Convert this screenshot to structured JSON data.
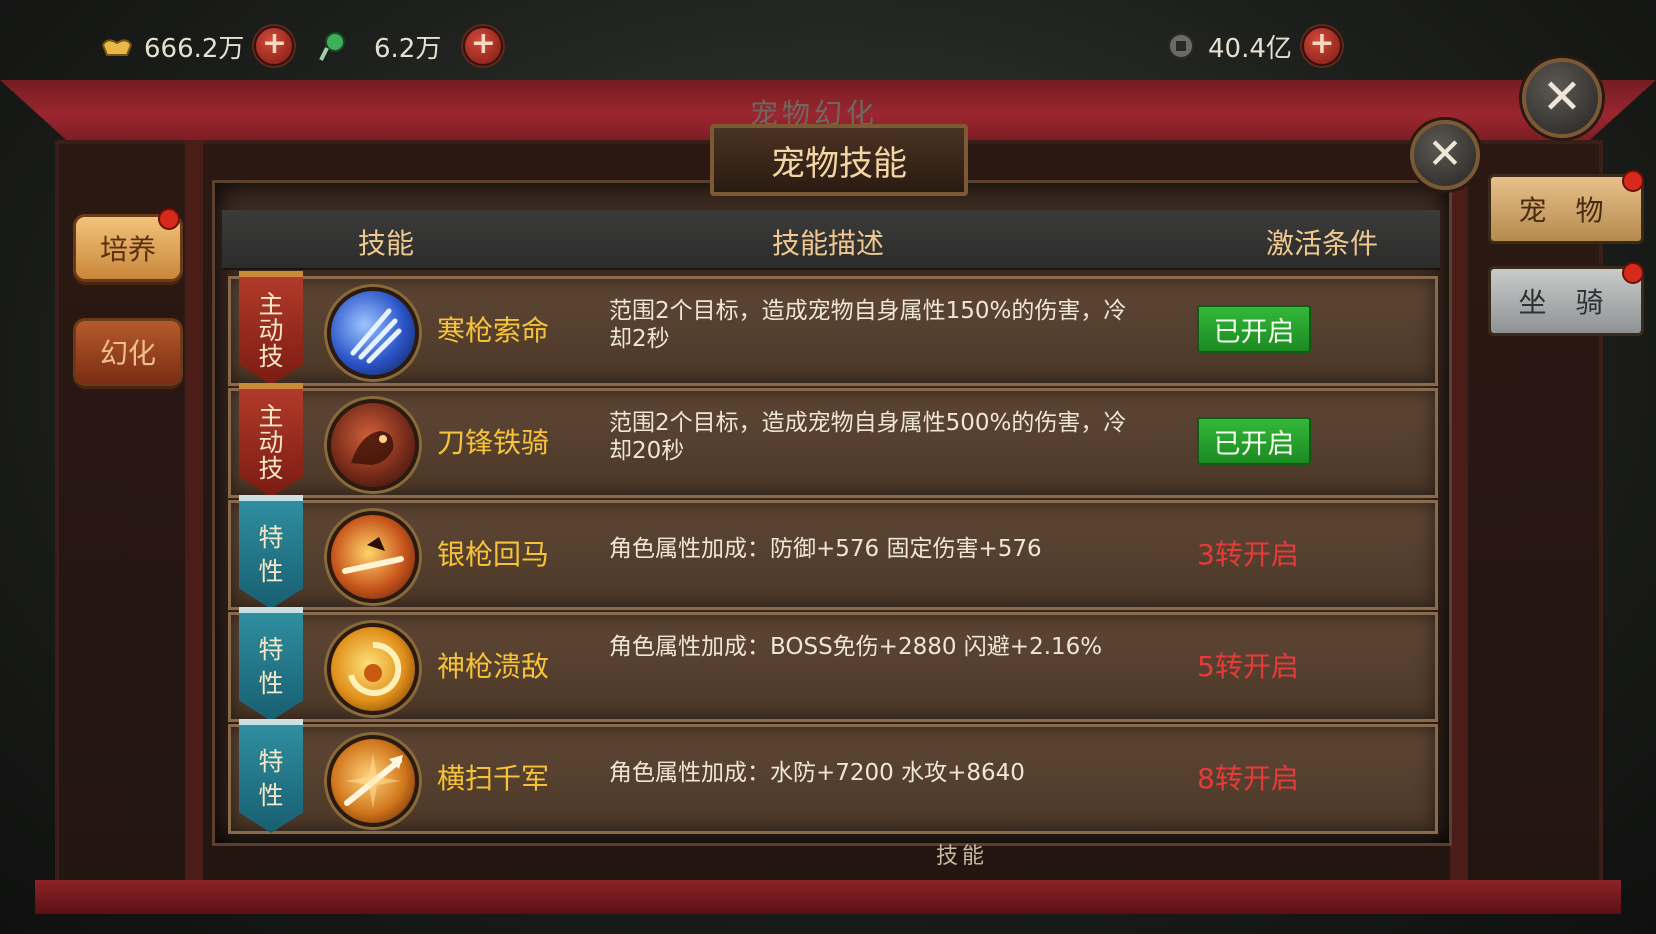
{
  "resources": [
    {
      "icon": "gold-ingot-icon",
      "value": "666.2万"
    },
    {
      "icon": "jade-icon",
      "value": "6.2万"
    },
    {
      "icon": "coin-icon",
      "value": "40.4亿"
    }
  ],
  "side_tabs": [
    "培养",
    "幻化"
  ],
  "right_tabs": [
    "宠 物",
    "坐 骑"
  ],
  "background_title": "宠物幻化",
  "dialog": {
    "title": "宠物技能",
    "headers": {
      "skill": "技能",
      "description": "技能描述",
      "condition": "激活条件"
    },
    "rows": [
      {
        "type": "主动技",
        "type_chars": [
          "主",
          "动",
          "技"
        ],
        "kind": "active",
        "name": "寒枪索命",
        "desc": "范围2个目标，造成宠物自身属性150%的伤害，冷却2秒",
        "status": "已开启",
        "unlocked": true,
        "icon": "ice-spear-icon",
        "icon_color": "#2b54c8"
      },
      {
        "type": "主动技",
        "type_chars": [
          "主",
          "动",
          "技"
        ],
        "kind": "active",
        "name": "刀锋铁骑",
        "desc": "范围2个目标，造成宠物自身属性500%的伤害，冷却20秒",
        "status": "已开启",
        "unlocked": true,
        "icon": "iron-cavalry-icon",
        "icon_color": "#7a2c1a"
      },
      {
        "type": "特性",
        "type_chars": [
          "特",
          "性"
        ],
        "kind": "trait",
        "name": "银枪回马",
        "desc": "角色属性加成：防御+576 固定伤害+576",
        "status": "3转开启",
        "unlocked": false,
        "icon": "silver-spear-icon",
        "icon_color": "#c8561c"
      },
      {
        "type": "特性",
        "type_chars": [
          "特",
          "性"
        ],
        "kind": "trait",
        "name": "神枪溃敌",
        "desc": "角色属性加成：BOSS免伤+2880 闪避+2.16%",
        "status": "5转开启",
        "unlocked": false,
        "icon": "divine-spear-icon",
        "icon_color": "#e0901a"
      },
      {
        "type": "特性",
        "type_chars": [
          "特",
          "性"
        ],
        "kind": "trait",
        "name": "横扫千军",
        "desc": "角色属性加成：水防+7200 水攻+8640",
        "status": "8转开启",
        "unlocked": false,
        "icon": "sweep-icon",
        "icon_color": "#d0761c"
      }
    ]
  },
  "bottom_tab": "技能"
}
